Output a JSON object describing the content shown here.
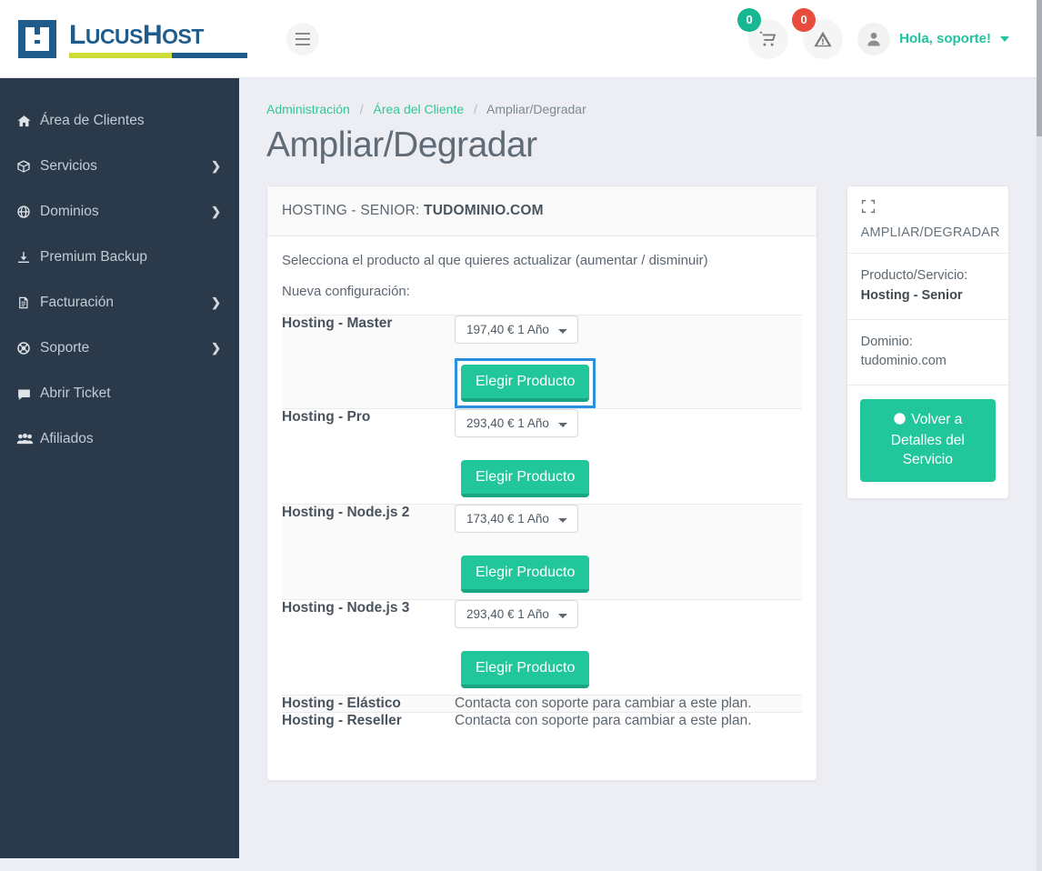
{
  "brand": {
    "name_part1": "L",
    "name_part2": "UCUS",
    "name_part3": "H",
    "name_part4": "OST",
    "logo_mark_text": "LH"
  },
  "header": {
    "menu_toggle": "menu-icon",
    "cart_badge": "0",
    "alert_badge": "0",
    "greeting": "Hola, soporte!"
  },
  "sidebar": {
    "items": [
      {
        "label": "Área de Clientes",
        "icon": "home-icon",
        "has_arrow": false
      },
      {
        "label": "Servicios",
        "icon": "box-icon",
        "has_arrow": true
      },
      {
        "label": "Dominios",
        "icon": "globe-icon",
        "has_arrow": true
      },
      {
        "label": "Premium Backup",
        "icon": "download-icon",
        "has_arrow": false
      },
      {
        "label": "Facturación",
        "icon": "invoice-icon",
        "has_arrow": true
      },
      {
        "label": "Soporte",
        "icon": "lifebuoy-icon",
        "has_arrow": true
      },
      {
        "label": "Abrir Ticket",
        "icon": "comment-icon",
        "has_arrow": false
      },
      {
        "label": "Afiliados",
        "icon": "users-icon",
        "has_arrow": false
      }
    ],
    "arrow_glyph": "❯"
  },
  "breadcrumb": {
    "item1": "Administración",
    "item2": "Área del Cliente",
    "item3": "Ampliar/Degradar",
    "separator": "/"
  },
  "page": {
    "title": "Ampliar/Degradar"
  },
  "card": {
    "header_prefix": "HOSTING - SENIOR: ",
    "header_domain": "TUDOMINIO.COM",
    "lead1": "Selecciona el producto al que quieres actualizar (aumentar / disminuir)",
    "lead2": "Nueva configuración:",
    "choose_button_label": "Elegir Producto",
    "rows": [
      {
        "name": "Hosting - Master",
        "price": "197,40 € 1 Año",
        "type": "select",
        "focused": true
      },
      {
        "name": "Hosting - Pro",
        "price": "293,40 € 1 Año",
        "type": "select",
        "focused": false
      },
      {
        "name": "Hosting - Node.js 2",
        "price": "173,40 € 1 Año",
        "type": "select",
        "focused": false
      },
      {
        "name": "Hosting - Node.js 3",
        "price": "293,40 € 1 Año",
        "type": "select",
        "focused": false
      },
      {
        "name": "Hosting - Elástico",
        "note": "Contacta con soporte para cambiar a este plan.",
        "type": "note"
      },
      {
        "name": "Hosting - Reseller",
        "note": "Contacta con soporte para cambiar a este plan.",
        "type": "note"
      }
    ]
  },
  "side_panel": {
    "title": "AMPLIAR/DEGRADAR",
    "icon": "expand-icon",
    "product_label": "Producto/Servicio:",
    "product_value": "Hosting - Senior",
    "domain_label": "Dominio:",
    "domain_value": "tudominio.com",
    "back_button": "Volver a Detalles del Servicio",
    "back_icon": "arrow-circle-left-icon"
  },
  "colors": {
    "accent_green": "#21c79b",
    "sidebar_bg": "#2b3a4a",
    "brand_blue": "#1f5c8b",
    "brand_lime": "#cddc39",
    "badge_red": "#e74c3c",
    "focus_blue": "#2b8fe0",
    "page_bg": "#eceef3"
  }
}
